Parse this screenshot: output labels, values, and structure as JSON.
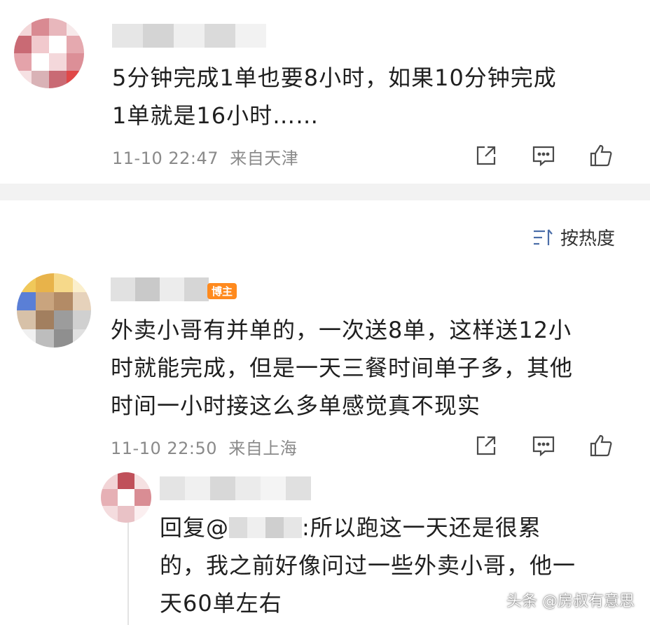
{
  "comments": [
    {
      "text_line1": "5分钟完成1单也要8小时，如果10分钟完成",
      "text_line2": "1单就是16小时……",
      "time": "11-10 22:47",
      "location": "来自天津"
    },
    {
      "badge": "博主",
      "text_line1": "外卖小哥有并单的，一次送8单，这样送12小",
      "text_line2": "时就能完成，但是一天三餐时间单子多，其他",
      "text_line3": "时间一小时接这么多单感觉真不现实",
      "time": "11-10 22:50",
      "location": "来自上海"
    }
  ],
  "sort": {
    "label": "按热度",
    "icon": "sort-icon"
  },
  "reply": {
    "prefix": "回复@",
    "text_line1_rest": ":所以跑这一天还是很累",
    "text_line2": "的，我之前好像问过一些外卖小哥，他一",
    "text_line3": "天60单左右"
  },
  "watermark": "头条 @房叔有意思",
  "icons": [
    "share-icon",
    "comment-icon",
    "like-icon"
  ],
  "colors": {
    "divider": "#f2f2f2",
    "meta": "#8a8a8a",
    "badge": "#ff8a1e"
  }
}
